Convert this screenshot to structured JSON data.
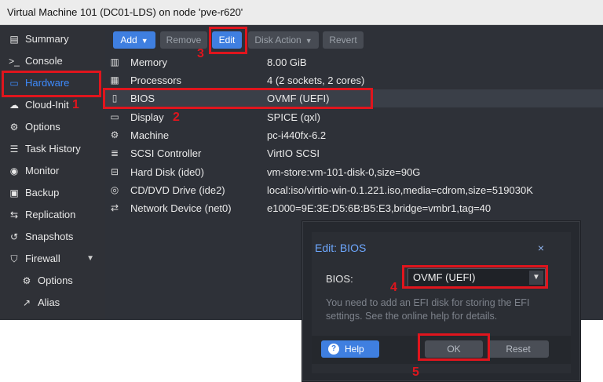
{
  "window": {
    "title": "Virtual Machine 101 (DC01-LDS) on node 'pve-r620'"
  },
  "sidebar": {
    "items": [
      {
        "label": "Summary",
        "icon": "book-icon"
      },
      {
        "label": "Console",
        "icon": "terminal-icon"
      },
      {
        "label": "Hardware",
        "icon": "monitor-icon",
        "active": true
      },
      {
        "label": "Cloud-Init",
        "icon": "cloud-icon"
      },
      {
        "label": "Options",
        "icon": "gear-icon"
      },
      {
        "label": "Task History",
        "icon": "list-icon"
      },
      {
        "label": "Monitor",
        "icon": "eye-icon"
      },
      {
        "label": "Backup",
        "icon": "floppy-icon"
      },
      {
        "label": "Replication",
        "icon": "retweet-icon"
      },
      {
        "label": "Snapshots",
        "icon": "history-icon"
      },
      {
        "label": "Firewall",
        "icon": "shield-icon"
      },
      {
        "label": "Options",
        "icon": "gear-icon"
      },
      {
        "label": "Alias",
        "icon": "external-link-icon"
      }
    ]
  },
  "toolbar": {
    "add_label": "Add",
    "remove_label": "Remove",
    "edit_label": "Edit",
    "disk_action_label": "Disk Action",
    "revert_label": "Revert"
  },
  "hardware": {
    "rows": [
      {
        "key": "Memory",
        "value": "8.00 GiB",
        "icon": "memory-icon"
      },
      {
        "key": "Processors",
        "value": "4 (2 sockets, 2 cores)",
        "icon": "cpu-icon"
      },
      {
        "key": "BIOS",
        "value": "OVMF (UEFI)",
        "icon": "microchip-icon"
      },
      {
        "key": "Display",
        "value": "SPICE (qxl)",
        "icon": "desktop-icon"
      },
      {
        "key": "Machine",
        "value": "pc-i440fx-6.2",
        "icon": "cogs-icon"
      },
      {
        "key": "SCSI Controller",
        "value": "VirtIO SCSI",
        "icon": "database-icon"
      },
      {
        "key": "Hard Disk (ide0)",
        "value": "vm-store:vm-101-disk-0,size=90G",
        "icon": "hdd-icon"
      },
      {
        "key": "CD/DVD Drive (ide2)",
        "value": "local:iso/virtio-win-0.1.221.iso,media=cdrom,size=519030K",
        "icon": "cdrom-icon"
      },
      {
        "key": "Network Device (net0)",
        "value": "e1000=9E:3E:D5:6B:B5:E3,bridge=vmbr1,tag=40",
        "icon": "exchange-icon"
      }
    ]
  },
  "dialog": {
    "title": "Edit: BIOS",
    "close": "×",
    "field_label": "BIOS:",
    "field_value": "OVMF (UEFI)",
    "info": "You need to add an EFI disk for storing the EFI settings. See the online help for details.",
    "help_label": "Help",
    "ok_label": "OK",
    "reset_label": "Reset"
  },
  "annotations": {
    "n1": "1",
    "n2": "2",
    "n3": "3",
    "n4": "4",
    "n5": "5"
  },
  "colors": {
    "annotation": "#e0151d",
    "accent": "#3f7fe0",
    "background": "#2e3138"
  }
}
